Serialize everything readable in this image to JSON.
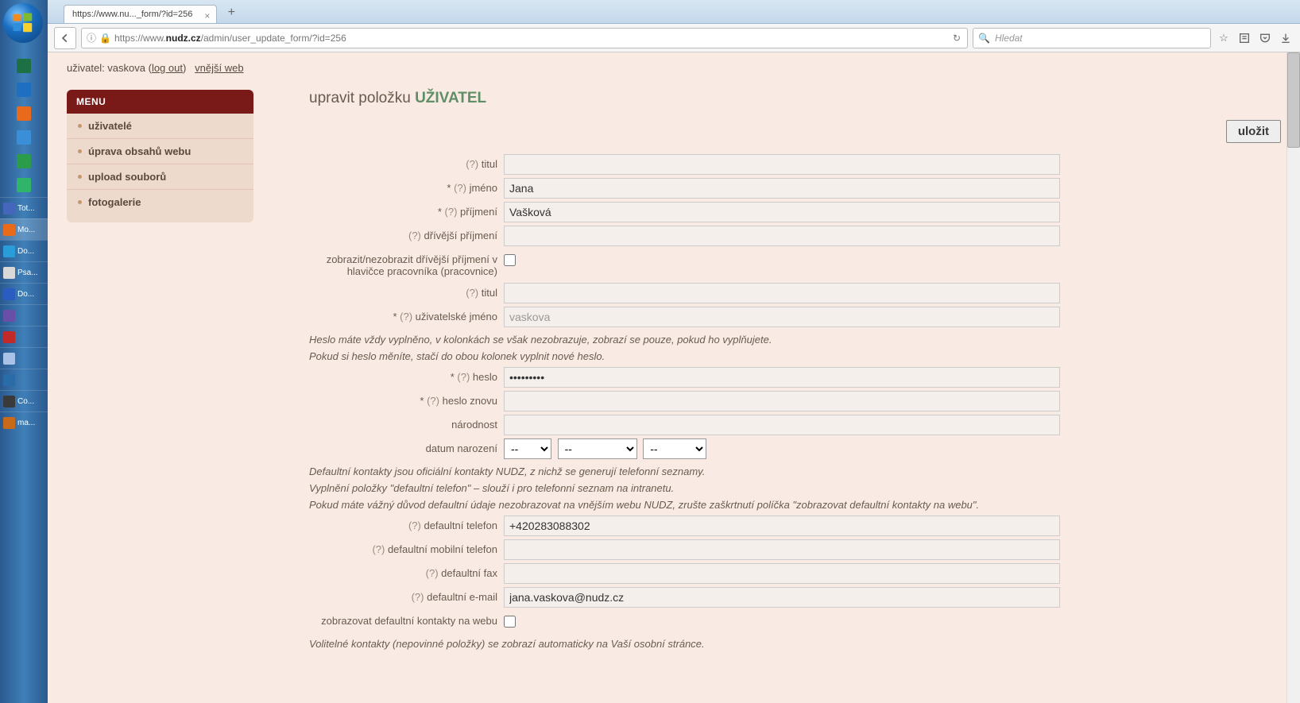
{
  "taskbar": {
    "items": [
      {
        "name": "excel-icon",
        "color": "#1d7044"
      },
      {
        "name": "ie-icon",
        "color": "#1e6fc2"
      },
      {
        "name": "media-icon",
        "color": "#e86a1a"
      },
      {
        "name": "files-icon",
        "color": "#3a8fd8"
      },
      {
        "name": "mail-icon",
        "color": "#2a9c4a"
      },
      {
        "name": "app-icon",
        "color": "#2fb46a"
      }
    ],
    "labeled": [
      {
        "name": "tot",
        "label": "Tot...",
        "icon_color": "#4466bb"
      },
      {
        "name": "mozilla",
        "label": "Mo...",
        "icon_color": "#e86a1a",
        "active": true
      },
      {
        "name": "do1",
        "label": "Do...",
        "icon_color": "#2a9cd8"
      },
      {
        "name": "psa",
        "label": "Psa...",
        "icon_color": "#d8d8d8"
      },
      {
        "name": "do2",
        "label": "Do...",
        "icon_color": "#2a5cc2"
      },
      {
        "name": "app2",
        "label": "",
        "icon_color": "#6a4fa8"
      },
      {
        "name": "pdf",
        "label": "",
        "icon_color": "#c22a2a"
      },
      {
        "name": "note",
        "label": "",
        "icon_color": "#a8c2e8"
      },
      {
        "name": "term",
        "label": "",
        "icon_color": "#2a6ca8"
      },
      {
        "name": "co",
        "label": "Co...",
        "icon_color": "#3a3a3a"
      },
      {
        "name": "ma",
        "label": "ma...",
        "icon_color": "#c86a1a"
      }
    ]
  },
  "browser": {
    "tab_title": "https://www.nu..._form/?id=256",
    "url_prefix": "https://www.",
    "url_bold": "nudz.cz",
    "url_suffix": "/admin/user_update_form/?id=256",
    "search_placeholder": "Hledat"
  },
  "header": {
    "user_label": "uživatel: vaskova (",
    "logout": "log out",
    "external": "vnější web"
  },
  "menu": {
    "title": "MENU",
    "items": [
      "uživatelé",
      "úprava obsahů webu",
      "upload souborů",
      "fotogalerie"
    ]
  },
  "title": {
    "prefix": "upravit položku ",
    "entity": "UŽIVATEL"
  },
  "save_label": "uložit",
  "help_mark": "(?)",
  "req_mark": "*",
  "fields": {
    "titul1": {
      "label": "titul",
      "value": ""
    },
    "jmeno": {
      "label": "jméno",
      "value": "Jana"
    },
    "prijmeni": {
      "label": "příjmení",
      "value": "Vašková"
    },
    "drivejsi": {
      "label": "dřívější příjmení",
      "value": ""
    },
    "zobrazit_drivejsi": {
      "label": "zobrazit/nezobrazit dřívější příjmení v hlavičce pracovníka (pracovnice)"
    },
    "titul2": {
      "label": "titul",
      "value": ""
    },
    "uzivatelske": {
      "label": "uživatelské jméno",
      "value": "vaskova"
    },
    "heslo": {
      "label": "heslo",
      "value": "•••••••••"
    },
    "heslo_znovu": {
      "label": "heslo znovu",
      "value": ""
    },
    "narodnost": {
      "label": "národnost",
      "value": ""
    },
    "datum": {
      "label": "datum narození",
      "day": "--",
      "month": "--",
      "year": "--"
    },
    "def_tel": {
      "label": "defaultní telefon",
      "value": "+420283088302"
    },
    "def_mob": {
      "label": "defaultní mobilní telefon",
      "value": ""
    },
    "def_fax": {
      "label": "defaultní fax",
      "value": ""
    },
    "def_email": {
      "label": "defaultní e-mail",
      "value": "jana.vaskova@nudz.cz"
    },
    "zobrazovat_def": {
      "label": "zobrazovat defaultní kontakty na webu"
    }
  },
  "notes": {
    "heslo1": "Heslo máte vždy vyplněno, v kolonkách se však nezobrazuje, zobrazí se pouze, pokud ho vyplňujete.",
    "heslo2": "Pokud si heslo měníte, stačí do obou kolonek vyplnit nové heslo.",
    "def1": "Defaultní kontakty jsou oficiální kontakty NUDZ, z nichž se generují telefonní seznamy.",
    "def2": "Vyplnění položky \"defaultní telefon\" – slouží i pro telefonní seznam na intranetu.",
    "def3": "Pokud máte vážný důvod defaultní údaje nezobrazovat na vnějším webu NUDZ, zrušte zaškrtnutí políčka \"zobrazovat defaultní kontakty na webu\".",
    "volitelne": "Volitelné kontakty (nepovinné položky) se zobrazí automaticky na Vaší osobní stránce."
  }
}
